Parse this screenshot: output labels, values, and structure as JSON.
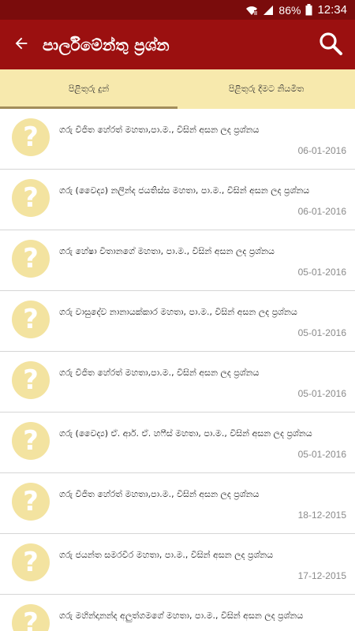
{
  "status_bar": {
    "battery": "86%",
    "time": "12:34"
  },
  "app_bar": {
    "title": "පාර්ලිමේන්තු ප්‍රශ්න"
  },
  "tabs": [
    {
      "label": "පිළිතුරු දුන්"
    },
    {
      "label": "පිළිතුරු දීමට නියමිත"
    }
  ],
  "list": {
    "items": [
      {
        "text": "ගරු විජිත හේරත් මහතා,පා.ම., විසින් අසන ලද ප්‍රශ්නය",
        "date": "06-01-2016"
      },
      {
        "text": "ගරු (වෛද්‍ය) නලින්ද ජයතිස්ස මහතා, පා.ම., විසින් අසන ලද ප්‍රශ්නය",
        "date": "06-01-2016"
      },
      {
        "text": "ගරු හේෂා විතානගේ මහතා, පා.ම., විසින් අසන ලද ප්‍රශ්නය",
        "date": "05-01-2016"
      },
      {
        "text": "ගරු වාසුදේව නානායක්කාර මහතා, පා.ම., විසින් අසන ලද ප්‍රශ්නය",
        "date": "05-01-2016"
      },
      {
        "text": "ගරු විජිත හේරත් මහතා,පා.ම., විසින් අසන ලද ප්‍රශ්නය",
        "date": "05-01-2016"
      },
      {
        "text": "ගරු (වෛද්‍ය) ඒ. ආර්. ඒ. හෆීස් මහතා, පා.ම., විසින් අසන ලද ප්‍රශ්නය",
        "date": "05-01-2016"
      },
      {
        "text": "ගරු විජිත හේරත් මහතා,පා.ම., විසින් අසන ලද ප්‍රශ්නය",
        "date": "18-12-2015"
      },
      {
        "text": "ගරු ජයන්ත සමරවීර මහතා, පා.ම., විසින් අසන ලද ප්‍රශ්නය",
        "date": "17-12-2015"
      },
      {
        "text": "ගරු මහින්දානන්ද අලුත්ගමගේ මහතා, පා.ම., විසින් අසන ලද ප්‍රශ්නය",
        "date": ""
      }
    ],
    "avatar_glyph": "?"
  },
  "colors": {
    "status_bar": "#7a0c0c",
    "app_bar": "#9b1010",
    "tab_bar": "#f7e9ad",
    "tab_indicator": "#a38d5a",
    "avatar": "#f3e3a0"
  }
}
